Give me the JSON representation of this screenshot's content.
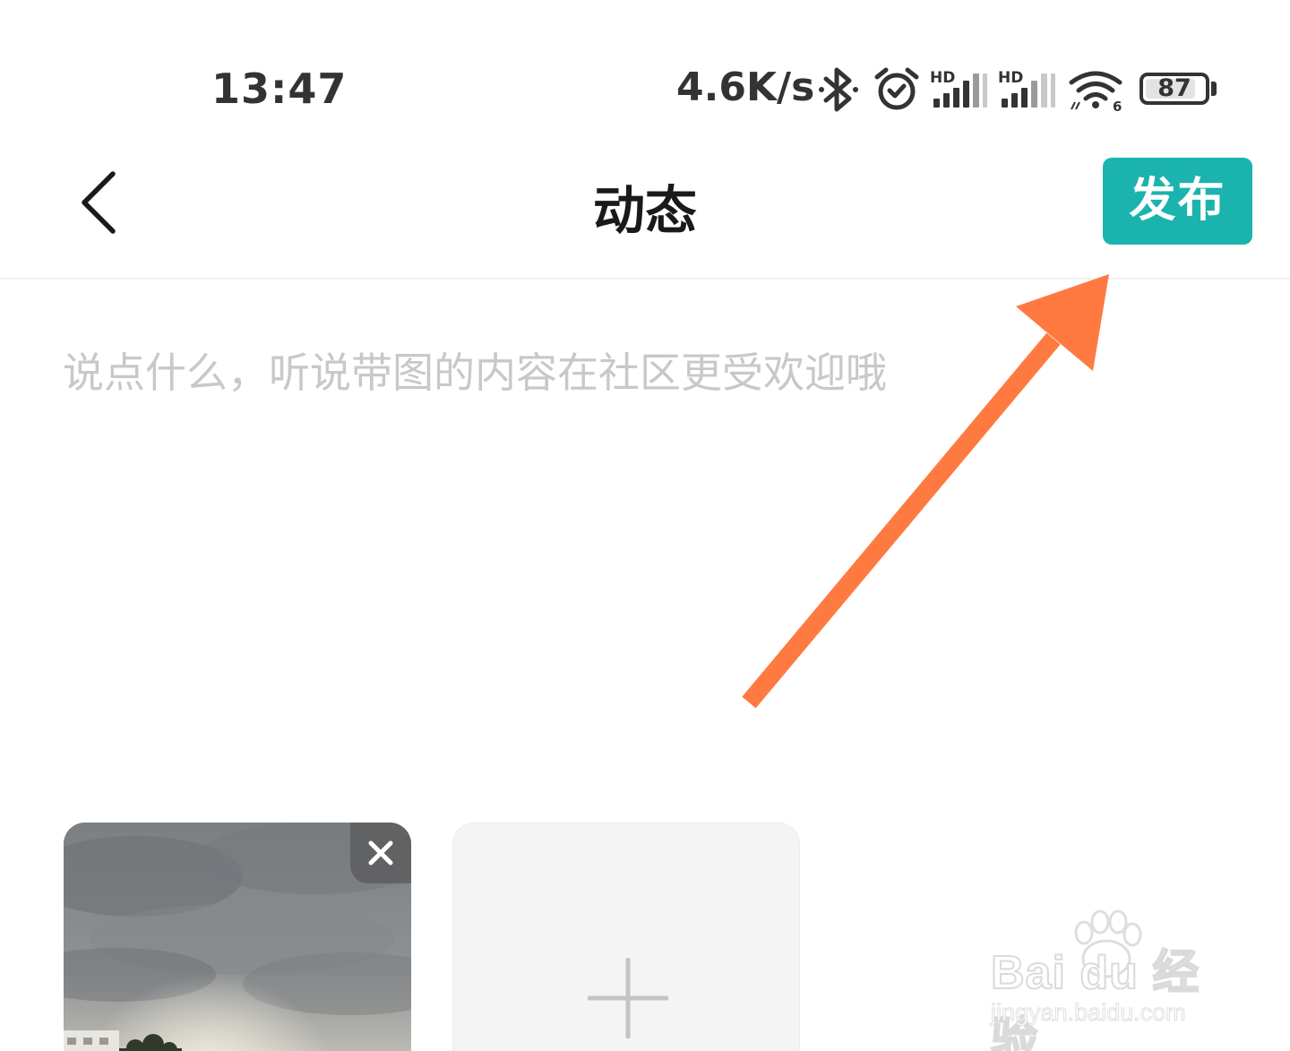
{
  "status_bar": {
    "time": "13:47",
    "network_speed": "4.6K/s",
    "battery_percent": "87",
    "battery_level": 0.87,
    "icons": [
      "bluetooth-icon",
      "alarm-icon",
      "signal-hd-icon",
      "signal-hd-icon",
      "wifi-6-icon",
      "battery-icon"
    ]
  },
  "header": {
    "back_icon": "chevron-left-icon",
    "title": "动态",
    "publish_label": "发布"
  },
  "composer": {
    "placeholder": "说点什么，听说带图的内容在社区更受欢迎哦",
    "value": ""
  },
  "media": {
    "photos": [
      {
        "name": "cloudy-sky-photo",
        "remove_icon": "close-icon"
      }
    ],
    "add_icon": "plus-icon"
  },
  "annotation": {
    "arrow_color": "#ff7a40"
  },
  "colors": {
    "accent": "#1bb3ae",
    "placeholder": "#c8c8c8",
    "title": "#1a1a1a"
  },
  "watermark": {
    "brand": "Bai du 经验",
    "url": "jingyan.baidu.com"
  }
}
